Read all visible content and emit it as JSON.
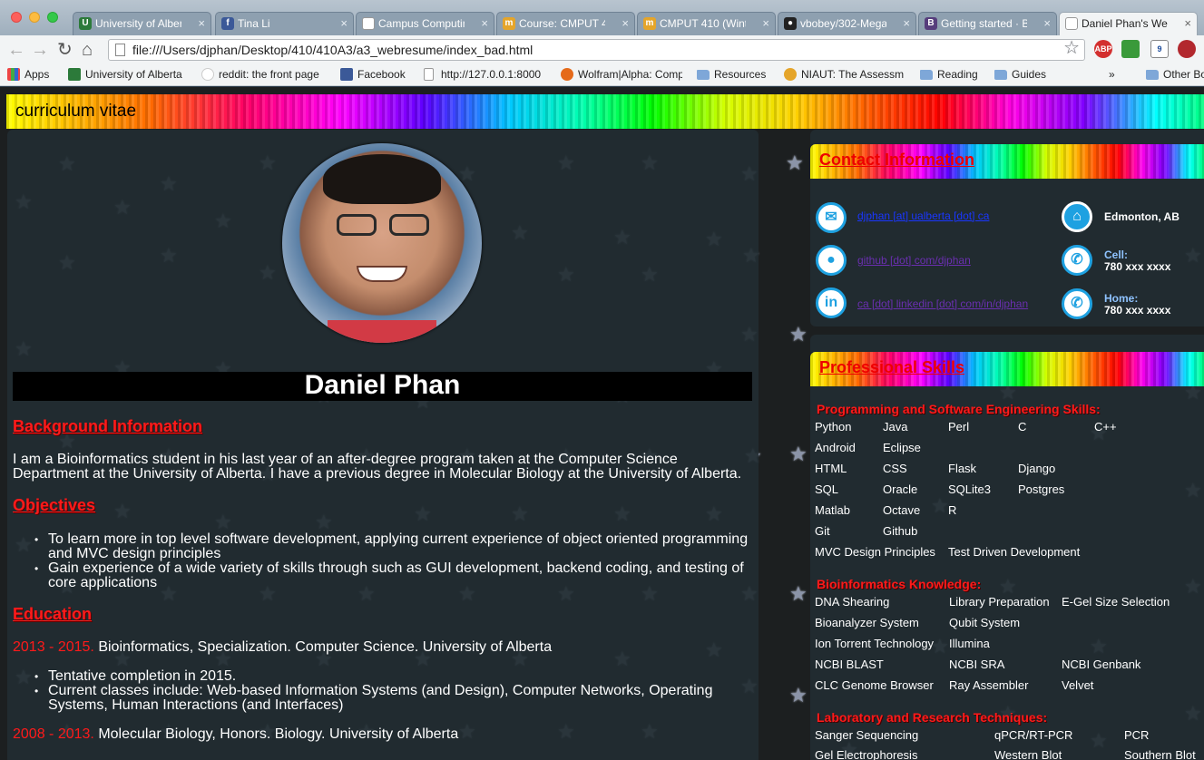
{
  "browser": {
    "tabs": [
      {
        "title": "University of Albert",
        "icon": "ualberta-icon",
        "color": "#2c7a3a"
      },
      {
        "title": "Tina Li",
        "icon": "facebook-icon",
        "color": "#3b5998"
      },
      {
        "title": "Campus Computing",
        "icon": "document-icon",
        "color": "#ffffff"
      },
      {
        "title": "Course: CMPUT 41",
        "icon": "moodle-icon",
        "color": "#e5a52a"
      },
      {
        "title": "CMPUT 410 (Winter",
        "icon": "moodle-icon",
        "color": "#e5a52a"
      },
      {
        "title": "vbobey/302-MegaF",
        "icon": "github-icon",
        "color": "#222222"
      },
      {
        "title": "Getting started · Bo",
        "icon": "bootstrap-icon",
        "color": "#563d7c"
      },
      {
        "title": "Daniel Phan's Web",
        "icon": "document-icon",
        "color": "#ffffff"
      }
    ],
    "url": "file:///Users/djphan/Desktop/410/410A3/a3_webresume/index_bad.html",
    "bookmarks": [
      {
        "label": "Apps",
        "icon": "apps-icon"
      },
      {
        "label": "University of Alberta",
        "icon": "ualberta-icon"
      },
      {
        "label": "reddit: the front page",
        "icon": "reddit-icon"
      },
      {
        "label": "Facebook",
        "icon": "facebook-icon"
      },
      {
        "label": "http://127.0.0.1:8000",
        "icon": "document-icon"
      },
      {
        "label": "Wolfram|Alpha: Comp",
        "icon": "wolfram-icon"
      },
      {
        "label": "Resources",
        "icon": "folder-icon"
      },
      {
        "label": "NIAUT: The Assessm",
        "icon": "moodle-icon"
      },
      {
        "label": "Reading",
        "icon": "folder-icon"
      },
      {
        "label": "Guides",
        "icon": "folder-icon"
      },
      {
        "label": "»",
        "icon": ""
      },
      {
        "label": "Other Bo",
        "icon": "folder-icon"
      }
    ],
    "extensions": [
      "ABP",
      "9"
    ]
  },
  "page": {
    "header": "curriculum vitae",
    "name": "Daniel Phan",
    "background": {
      "heading": "Background Information",
      "text": "I am a Bioinformatics student in his last year of an after-degree program taken at the Computer Science Department at the University of Alberta. I have a previous degree in Molecular Biology at the University of Alberta."
    },
    "objectives": {
      "heading": "Objectives",
      "items": [
        "To learn more in top level software development, applying current experience of object oriented programming and MVC design principles",
        "Gain experience of a wide variety of skills through such as GUI development, backend coding, and testing of core applications"
      ]
    },
    "education": {
      "heading": "Education",
      "entries": [
        {
          "years": "2013 - 2015.",
          "desc": "Bioinformatics, Specialization. Computer Science. University of Alberta",
          "items": [
            "Tentative completion in 2015.",
            "Current classes include: Web-based Information Systems (and Design), Computer Networks, Operating Systems, Human Interactions (and Interfaces)"
          ]
        },
        {
          "years": "2008 - 2013.",
          "desc": "Molecular Biology, Honors. Biology. University of Alberta",
          "items": []
        }
      ]
    },
    "contact": {
      "heading": "Contact Information",
      "email": "djphan [at] ualberta [dot] ca",
      "github": "github [dot] com/djphan",
      "linkedin": "ca [dot] linkedin [dot] com/in/djphan",
      "location": "Edmonton, AB",
      "cell_label": "Cell:",
      "cell": "780 xxx xxxx",
      "home_label": "Home:",
      "home": "780 xxx xxxx"
    },
    "skills": {
      "heading": "Professional Skills",
      "programming_heading": "Programming and Software Engineering Skills:",
      "programming": [
        [
          "Python",
          "Java",
          "Perl",
          "C",
          "C++"
        ],
        [
          "Android",
          "Eclipse"
        ],
        [
          "HTML",
          "CSS",
          "Flask",
          "Django"
        ],
        [
          "SQL",
          "Oracle",
          "SQLite3",
          "Postgres"
        ],
        [
          "Matlab",
          "Octave",
          "R"
        ],
        [
          "Git",
          "Github"
        ],
        [
          "MVC Design Principles",
          "Test Driven Development"
        ]
      ],
      "bio_heading": "Bioinformatics Knowledge:",
      "bio": [
        [
          "DNA Shearing",
          "Library Preparation",
          "E-Gel Size Selection"
        ],
        [
          "Bioanalyzer System",
          "Qubit System"
        ],
        [
          "Ion Torrent Technology",
          "Illumina"
        ],
        [
          "NCBI BLAST",
          "NCBI SRA",
          "NCBI Genbank"
        ],
        [
          "CLC Genome Browser",
          "Ray Assembler",
          "Velvet"
        ]
      ],
      "lab_heading": "Laboratory and Research Techniques:",
      "lab": [
        [
          "Sanger Sequencing",
          "qPCR/RT-PCR",
          "PCR"
        ],
        [
          "Gel Electrophoresis",
          "Western Blot",
          "Southern Blot"
        ]
      ]
    }
  }
}
